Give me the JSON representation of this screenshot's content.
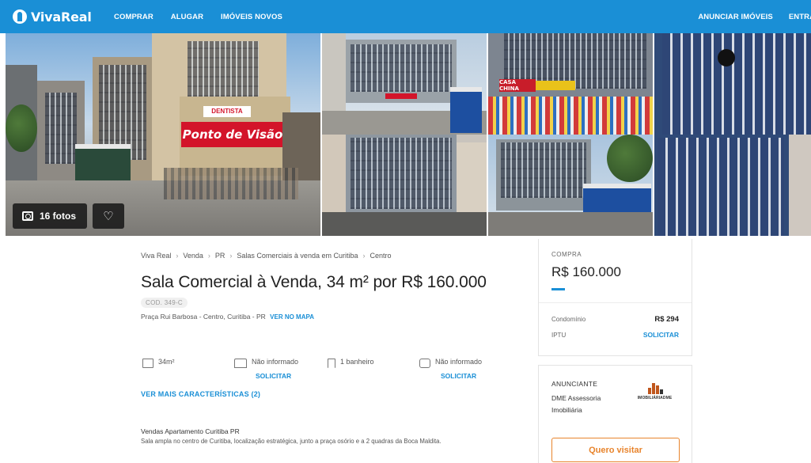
{
  "header": {
    "logo_text": "VivaReal",
    "nav": [
      "COMPRAR",
      "ALUGAR",
      "IMÓVEIS NOVOS"
    ],
    "right_nav": [
      "ANUNCIAR IMÓVEIS",
      "ENTRAR"
    ],
    "color": "#1a8fd6"
  },
  "gallery": {
    "photo_count_label": "16 fotos",
    "favorite_icon": "heart-icon",
    "camera_icon": "camera-icon",
    "sign_text_1": "Ponto de Visão",
    "sign_text_2": "DENTISTA",
    "sign_text_3": "CASA CHINA"
  },
  "breadcrumb": [
    "Viva Real",
    "Venda",
    "PR",
    "Salas Comerciais à venda em Curitiba",
    "Centro"
  ],
  "listing": {
    "title": "Sala Comercial à Venda, 34 m² por R$ 160.000",
    "code": "COD. 349-C",
    "address": "Praça Rui Barbosa - Centro, Curitiba - PR",
    "map_link": "VER NO MAPA",
    "features": [
      {
        "icon": "area-icon",
        "value": "34m²",
        "action": ""
      },
      {
        "icon": "bed-icon",
        "value": "Não informado",
        "action": "SOLICITAR"
      },
      {
        "icon": "shower-icon",
        "value": "1 banheiro",
        "action": ""
      },
      {
        "icon": "car-icon",
        "value": "Não informado",
        "action": "SOLICITAR"
      }
    ],
    "more_features": "VER MAIS CARACTERÍSTICAS (2)",
    "description_title": "Vendas Apartamento Curitiba PR",
    "description": "Sala ampla no centro de Curitiba, localização estratégica, junto a praça osório e a 2 quadras da Boca Maldita."
  },
  "price_card": {
    "label": "COMPRA",
    "price": "R$ 160.000",
    "condominio_label": "Condomínio",
    "condominio_value": "R$ 294",
    "iptu_label": "IPTU",
    "iptu_action": "SOLICITAR"
  },
  "advertiser": {
    "label": "ANUNCIANTE",
    "name": "DME Assessoria Imobiliária",
    "logo_text": "IMOBILIÁRIADME",
    "visit_button": "Quero visitar",
    "accent": "#e8842c"
  }
}
